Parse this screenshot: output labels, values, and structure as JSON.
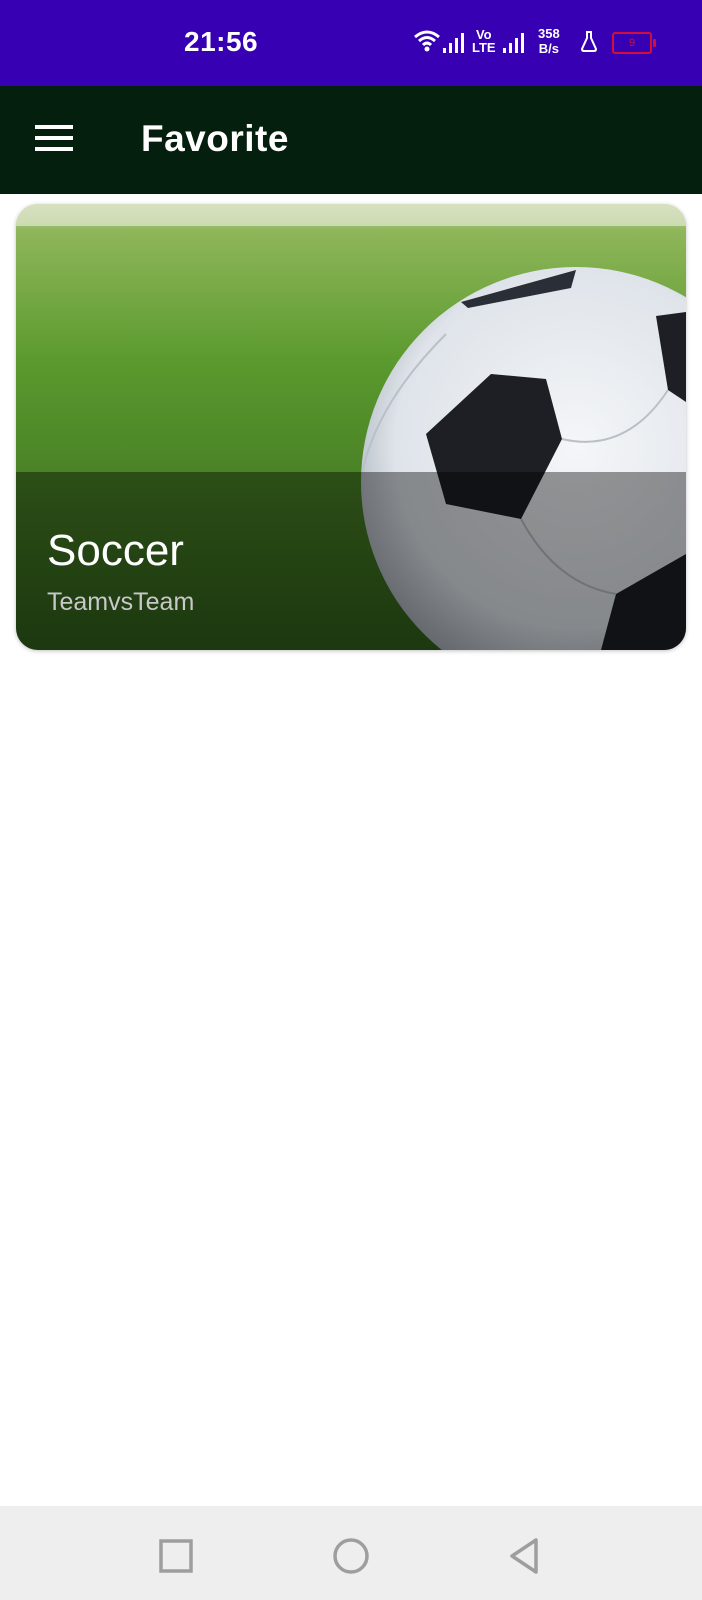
{
  "status_bar": {
    "time": "21:56",
    "network_type": "Vo\nLTE",
    "speed_value": "358",
    "speed_unit": "B/s",
    "battery_level": "9",
    "icons": [
      "wifi-icon",
      "signal-icon",
      "volte-icon",
      "signal-icon",
      "lab-icon",
      "battery-icon"
    ]
  },
  "app_bar": {
    "title": "Favorite",
    "menu_icon": "hamburger-menu-icon"
  },
  "cards": [
    {
      "title": "Soccer",
      "subtitle": "TeamvsTeam",
      "image": "soccer-ball-on-grass"
    }
  ],
  "nav_bar": {
    "buttons": [
      "recent-apps",
      "home",
      "back"
    ]
  },
  "colors": {
    "status_bar": "#3700b3",
    "app_bar": "#041f0d",
    "background": "#ffffff",
    "nav_bar": "#eeeeee",
    "battery_low": "#d0103a"
  }
}
